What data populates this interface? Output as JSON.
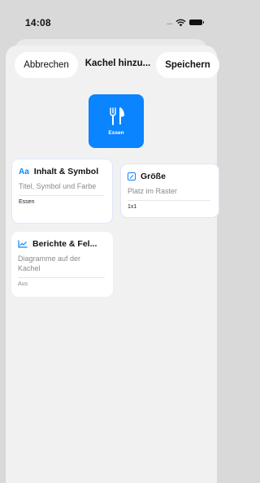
{
  "status_bar": {
    "time": "14:08",
    "signal": "....",
    "wifi_icon": "wifi-icon",
    "battery_icon": "battery-icon"
  },
  "header": {
    "cancel_label": "Abbrechen",
    "title": "Kachel hinzu...",
    "save_label": "Speichern"
  },
  "tile": {
    "label": "Essen",
    "icon": "fork-knife-icon",
    "color": "#0a84ff"
  },
  "cards": {
    "content": {
      "icon": "Aa",
      "title": "Inhalt & Symbol",
      "subtitle": "Titel, Symbol und Farbe",
      "value": "Essen"
    },
    "size": {
      "title": "Größe",
      "subtitle": "Platz im Raster",
      "value": "1x1"
    },
    "reports": {
      "icon": "chart-line-icon",
      "title": "Berichte & Fel...",
      "subtitle": "Diagramme auf der Kachel",
      "value": "Aus"
    }
  },
  "accent_color": "#0a84ff"
}
